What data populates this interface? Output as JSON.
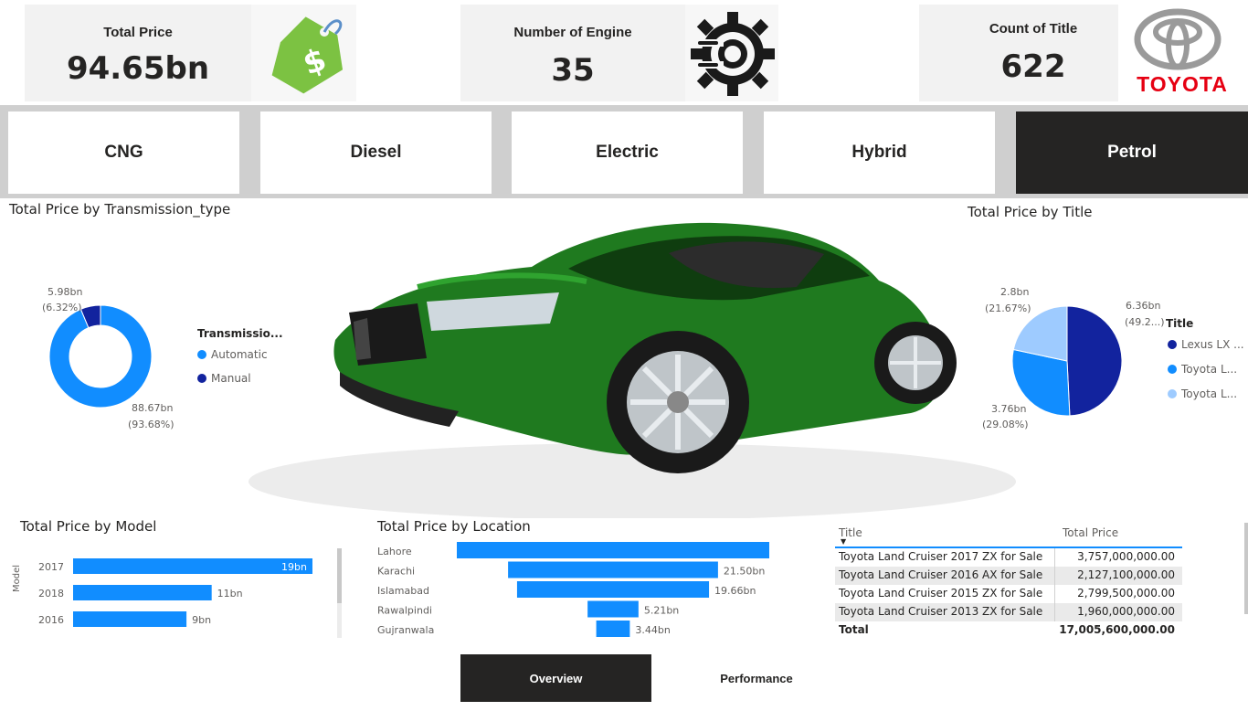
{
  "kpis": {
    "total_price": {
      "title": "Total Price",
      "value": "94.65bn",
      "icon": "price-tag-dollar-icon",
      "color": "#7cc242"
    },
    "engine": {
      "title": "Number of Engine",
      "value": "35",
      "icon": "gear-engine-icon"
    },
    "count_title": {
      "title": "Count of Title",
      "value": "622",
      "brand": "TOYOTA",
      "brand_color": "#e60012"
    }
  },
  "slicer": {
    "options": [
      "CNG",
      "Diesel",
      "Electric",
      "Hybrid",
      "Petrol"
    ],
    "selected": "Petrol"
  },
  "hero": {
    "image": "green-sports-car",
    "color": "#1f7a1f"
  },
  "transmission_chart": {
    "title": "Total Price by Transmission_type",
    "legend_title": "Transmissio...",
    "legend": [
      "Automatic",
      "Manual"
    ],
    "label_manual_value": "5.98bn",
    "label_manual_pct": "(6.32%)",
    "label_auto_value": "88.67bn",
    "label_auto_pct": "(93.68%)"
  },
  "title_chart": {
    "title": "Total Price by Title",
    "legend_title": "Title",
    "legend": [
      "Lexus LX ...",
      "Toyota L...",
      "Toyota L..."
    ],
    "label_a_value": "6.36bn",
    "label_a_pct": "(49.2...)",
    "label_b_value": "3.76bn",
    "label_b_pct": "(29.08%)",
    "label_c_value": "2.8bn",
    "label_c_pct": "(21.67%)"
  },
  "model_chart": {
    "title": "Total Price by Model",
    "axis_label": "Model"
  },
  "location_chart": {
    "title": "Total Price by Location"
  },
  "chart_data": [
    {
      "type": "pie",
      "title": "Total Price by Transmission_type",
      "categories": [
        "Automatic",
        "Manual"
      ],
      "values": [
        88.67,
        5.98
      ],
      "unit": "bn",
      "colors": [
        "#118dff",
        "#12239e"
      ]
    },
    {
      "type": "pie",
      "title": "Total Price by Title",
      "categories": [
        "Lexus LX ...",
        "Toyota L...",
        "Toyota L..."
      ],
      "values": [
        6.36,
        3.76,
        2.8
      ],
      "unit": "bn",
      "colors": [
        "#12239e",
        "#118dff",
        "#9ecbff"
      ]
    },
    {
      "type": "bar",
      "title": "Total Price by Model",
      "ylabel": "Model",
      "categories": [
        "2017",
        "2018",
        "2016"
      ],
      "values": [
        19,
        11,
        9
      ],
      "labels": [
        "19bn",
        "11bn",
        "9bn"
      ],
      "xlim": [
        0,
        19
      ],
      "color": "#118dff"
    },
    {
      "type": "bar",
      "title": "Total Price by Location",
      "categories": [
        "Lahore",
        "Karachi",
        "Islamabad",
        "Rawalpindi",
        "Gujranwala"
      ],
      "values": [
        32.0,
        21.5,
        19.66,
        5.21,
        3.44
      ],
      "labels": [
        "",
        "21.50bn",
        "19.66bn",
        "5.21bn",
        "3.44bn"
      ],
      "xlim": [
        0,
        32
      ],
      "color": "#118dff"
    }
  ],
  "table": {
    "col_title": "Title",
    "col_price": "Total Price",
    "rows": [
      {
        "title": "Toyota Land Cruiser 2017 ZX for Sale",
        "price": "3,757,000,000.00"
      },
      {
        "title": "Toyota Land Cruiser 2016 AX for Sale",
        "price": "2,127,100,000.00"
      },
      {
        "title": "Toyota Land Cruiser 2015 ZX for Sale",
        "price": "2,799,500,000.00"
      },
      {
        "title": "Toyota Land Cruiser 2013 ZX for Sale",
        "price": "1,960,000,000.00"
      }
    ],
    "total_label": "Total",
    "total_value": "17,005,600,000.00"
  },
  "nav": {
    "overview": "Overview",
    "performance": "Performance",
    "active": "Overview"
  }
}
